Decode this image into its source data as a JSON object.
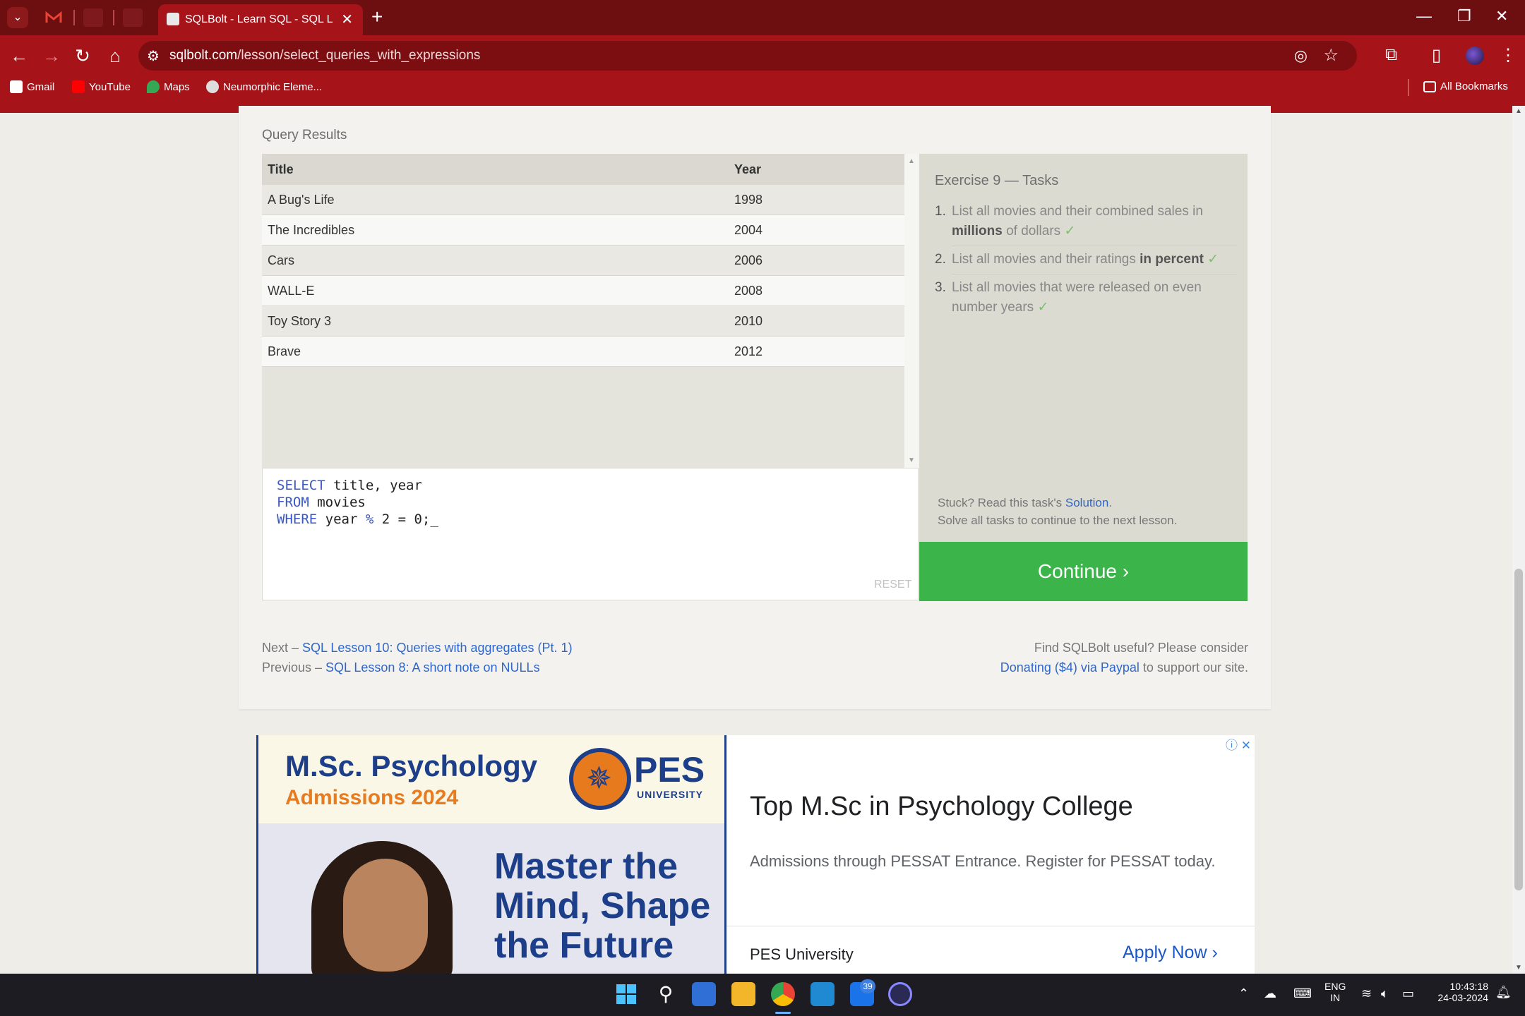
{
  "browser": {
    "active_tab_title": "SQLBolt - Learn SQL - SQL Less",
    "url_domain": "sqlbolt.com",
    "url_path": "/lesson/select_queries_with_expressions",
    "bookmarks": [
      "Gmail",
      "YouTube",
      "Maps",
      "Neumorphic Eleme..."
    ],
    "all_bookmarks": "All Bookmarks"
  },
  "lesson": {
    "query_results_label": "Query Results",
    "columns": [
      "Title",
      "Year"
    ],
    "rows": [
      [
        "A Bug's Life",
        "1998"
      ],
      [
        "The Incredibles",
        "2004"
      ],
      [
        "Cars",
        "2006"
      ],
      [
        "WALL-E",
        "2008"
      ],
      [
        "Toy Story 3",
        "2010"
      ],
      [
        "Brave",
        "2012"
      ]
    ],
    "query": {
      "line1_kw": "SELECT",
      "line1_rest": " title, year",
      "line2_kw": "FROM",
      "line2_rest": " movies",
      "line3_kw": "WHERE",
      "line3_a": " year ",
      "line3_op": "%",
      "line3_b": " 2 = 0;_"
    },
    "reset_label": "RESET",
    "tasks_header": "Exercise 9 — Tasks",
    "tasks": [
      {
        "num": "1.",
        "pre": "List all movies and their combined sales in ",
        "bold": "millions",
        "post": " of dollars",
        "check": "✓"
      },
      {
        "num": "2.",
        "pre": "List all movies and their ratings ",
        "bold": "in percent",
        "post": "",
        "check": "✓"
      },
      {
        "num": "3.",
        "pre": "List all movies that were released on even number years",
        "bold": "",
        "post": "",
        "check": "✓"
      }
    ],
    "stuck_text": "Stuck? Read this task's ",
    "solution_link": "Solution",
    "stuck_end": ".",
    "solve_all": "Solve all tasks to continue to the next lesson.",
    "continue_label": "Continue ›",
    "next_prefix": "Next – ",
    "next_link": "SQL Lesson 10: Queries with aggregates (Pt. 1)",
    "prev_prefix": "Previous – ",
    "prev_link": "SQL Lesson 8: A short note on NULLs",
    "donate_line1": "Find SQLBolt useful? Please consider",
    "donate_link": "Donating ($4) via Paypal",
    "donate_end": " to support our site."
  },
  "ad": {
    "headline1": "M.Sc. Psychology",
    "headline2": "Admissions 2024",
    "logo_text": "PES",
    "logo_sub": "UNIVERSITY",
    "tagline": [
      "Master the",
      "Mind, Shape",
      "the Future"
    ],
    "title": "Top M.Sc in Psychology College",
    "description": "Admissions through PESSAT Entrance. Register for PESSAT today.",
    "brand": "PES University",
    "cta": "Apply Now"
  },
  "taskbar": {
    "lang1": "ENG",
    "lang2": "IN",
    "time": "10:43:18",
    "date": "24-03-2024",
    "badge": "39"
  }
}
